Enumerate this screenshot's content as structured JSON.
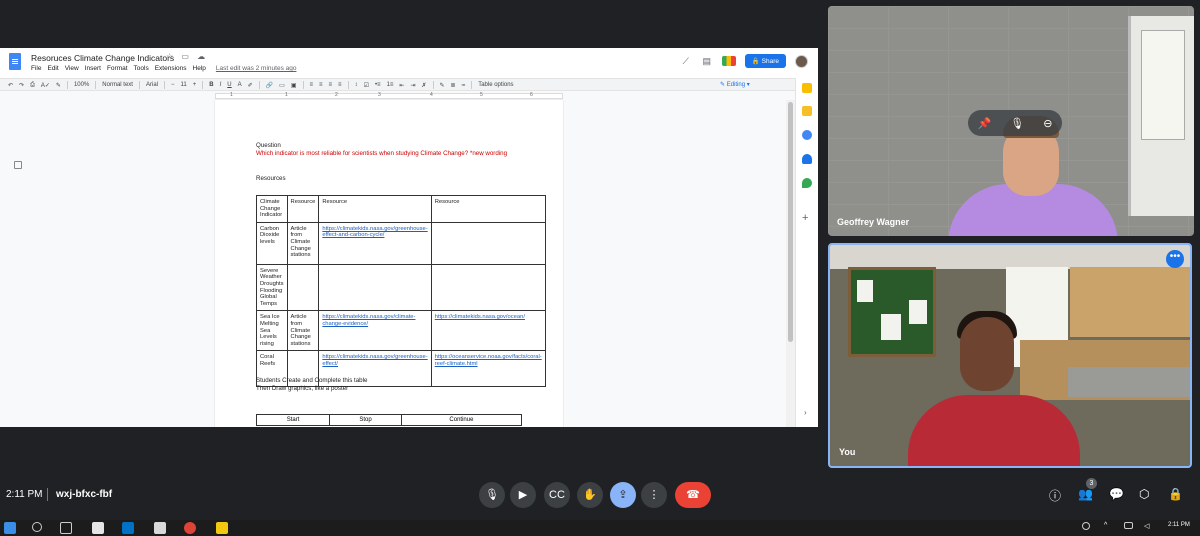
{
  "doc": {
    "title": "Resoruces Climate Change Indicators",
    "menu": [
      "File",
      "Edit",
      "View",
      "Insert",
      "Format",
      "Tools",
      "Extensions",
      "Help"
    ],
    "last_edit": "Last edit was 2 minutes ago",
    "share_label": "Share",
    "toolbar": {
      "zoom": "100%",
      "style": "Normal text",
      "font": "Arial",
      "size": "11",
      "table_options": "Table options",
      "mode": "Editing"
    },
    "ruler_numbers": [
      "1",
      "1",
      "2",
      "3",
      "4",
      "5",
      "6"
    ],
    "question_label": "Question",
    "question_text": "Which indicator is most reliable for scientists when studying Climate Change? *new wording",
    "resources_heading": "Resources",
    "table_headers": [
      "Climate Change Indicator",
      "Resource",
      "Resource",
      "Resource"
    ],
    "table_rows": [
      [
        "Carbon Dioxide levels",
        "Article from Climate Change stations",
        "https://climatekids.nasa.gov/greenhouse-effect-and-carbon-cycle/",
        ""
      ],
      [
        "Severe Weather\nDroughts\nFlooding\nGlobal Temps",
        "",
        "",
        ""
      ],
      [
        "Sea Ice Melting\nSea Levels rising",
        "Article from Climate Change stations",
        "https://climatekids.nasa.gov/climate-change-evidence/",
        "https://climatekids.nasa.gov/ocean/"
      ],
      [
        "Coral Reefs",
        "",
        "https://climatekids.nasa.gov/greenhouse-effect/",
        "https://oceanservice.noaa.gov/facts/coral-reef-climate.html"
      ]
    ],
    "students_line1": "Students Create and Complete this table",
    "students_line2": "Then Draw graphics, like a poster",
    "ssc_headers": [
      "Start",
      "Stop",
      "Continue"
    ]
  },
  "participants": [
    {
      "name": "Geoffrey Wagner"
    },
    {
      "name": "You"
    }
  ],
  "bottom_bar": {
    "time": "2:11 PM",
    "meeting_code": "wxj-bfxc-fbf",
    "people_count": "3"
  },
  "taskbar": {
    "clock": "2:11 PM"
  },
  "colors": {
    "meet_bg": "#202124",
    "end_call": "#ea4335",
    "active_control": "#8ab4f8",
    "share_button": "#1a73e8",
    "question_red": "#cc0000"
  }
}
